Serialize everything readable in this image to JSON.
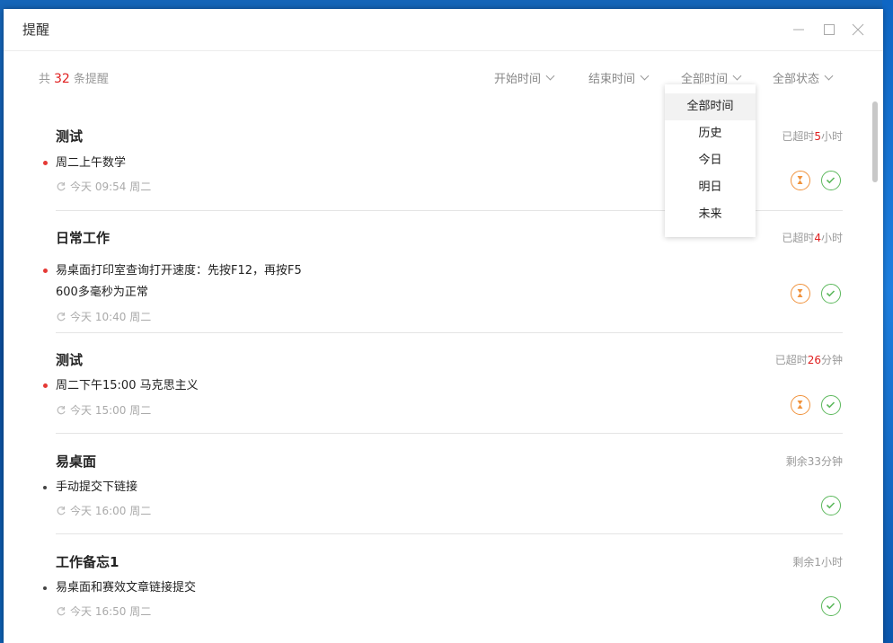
{
  "window": {
    "title": "提醒"
  },
  "toolbar": {
    "count_prefix": "共",
    "count_value": "32",
    "count_suffix": "条提醒",
    "filters": [
      {
        "label": "开始时间"
      },
      {
        "label": "结束时间"
      },
      {
        "label": "全部时间"
      },
      {
        "label": "全部状态"
      }
    ]
  },
  "dropdown": {
    "options": [
      "全部时间",
      "历史",
      "今日",
      "明日",
      "未来"
    ],
    "selected": "全部时间"
  },
  "reminders": [
    {
      "title": "测试",
      "lines": [
        "周二上午数学"
      ],
      "meta": "今天 09:54 周二",
      "status_prefix": "已超时",
      "status_value": "5",
      "status_suffix": "小时",
      "bullet_color": "#e53935",
      "actions": [
        "hourglass-icon",
        "check-icon"
      ]
    },
    {
      "title": "日常工作",
      "lines": [
        "易桌面打印室查询打开速度：先按F12，再按F5",
        "600多毫秒为正常"
      ],
      "meta": "今天 10:40 周二",
      "status_prefix": "已超时",
      "status_value": "4",
      "status_suffix": "小时",
      "bullet_color": "#e53935",
      "actions": [
        "hourglass-icon",
        "check-icon"
      ]
    },
    {
      "title": "测试",
      "lines": [
        "周二下午15:00 马克思主义"
      ],
      "meta": "今天 15:00 周二",
      "status_prefix": "已超时",
      "status_value": "26",
      "status_suffix": "分钟",
      "bullet_color": "#e53935",
      "actions": [
        "hourglass-icon",
        "check-icon"
      ]
    },
    {
      "title": "易桌面",
      "lines": [
        "手动提交下链接"
      ],
      "meta": "今天 16:00 周二",
      "status": "剩余33分钟",
      "bullet_color": "#444444",
      "actions": [
        "check-icon"
      ]
    },
    {
      "title": "工作备忘1",
      "lines": [
        "易桌面和赛效文章链接提交"
      ],
      "meta": "今天 16:50 周二",
      "status": "剩余1小时",
      "bullet_color": "#444444",
      "actions": [
        "check-icon"
      ]
    }
  ],
  "colors": {
    "accent_red": "#e02020",
    "hourglass_orange": "#f0923c",
    "check_green": "#5cb85c",
    "desktop_blue": "#0b4d9c"
  }
}
